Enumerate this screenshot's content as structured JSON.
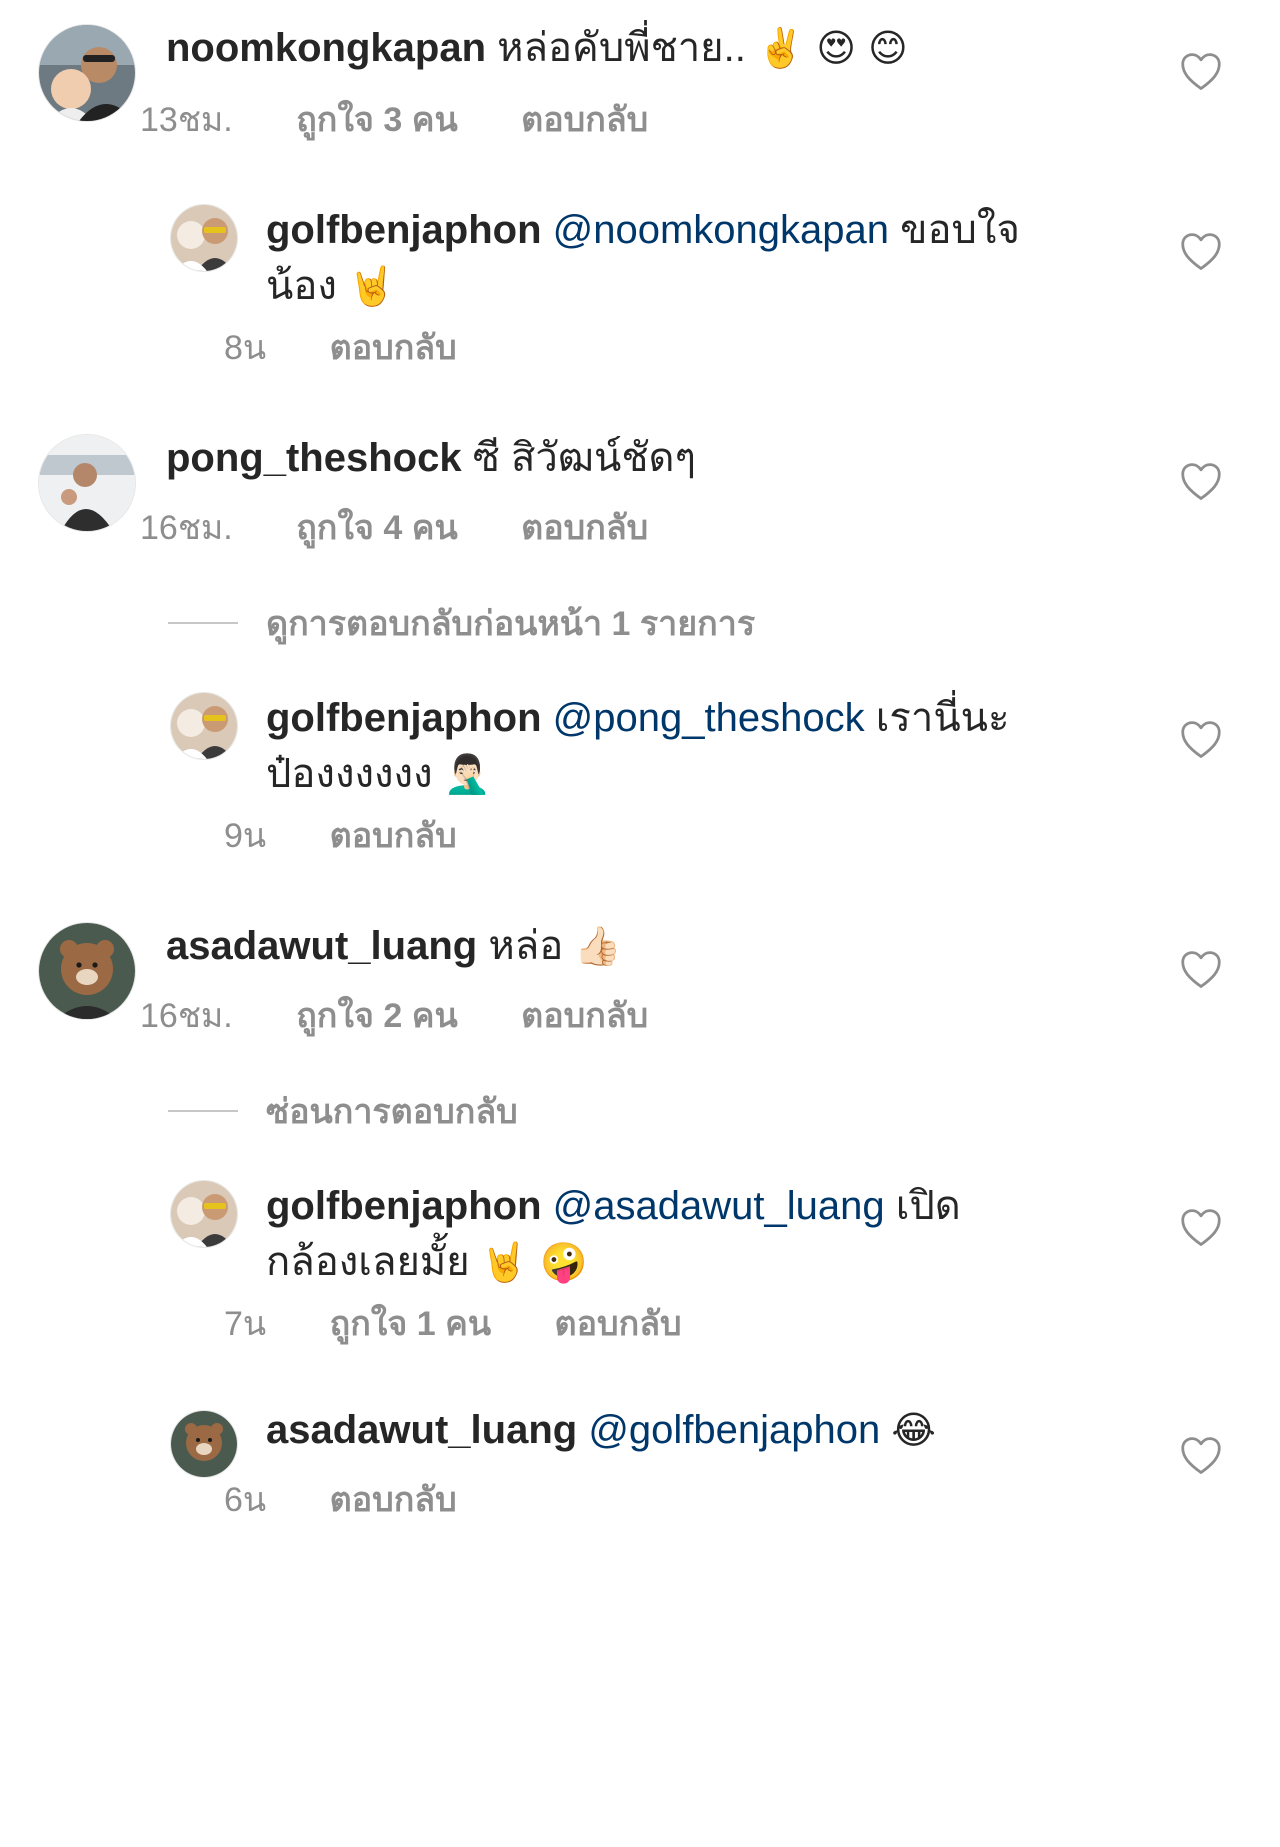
{
  "colors": {
    "username": "#262626",
    "mention": "#00376b",
    "meta": "#8e8e8e",
    "divider": "#c7c7c7"
  },
  "icons": {
    "like": "heart-outline-icon"
  },
  "comments": [
    {
      "username": "noomkongkapan",
      "text": "หล่อคับพี่ชาย..",
      "emoji": "✌️ 😍 😊",
      "time": "13ชม.",
      "likes": "ถูกใจ 3 คน",
      "reply": "ตอบกลับ"
    },
    {
      "username": "golfbenjaphon",
      "mention": "@noomkongkapan",
      "text_a": "ขอบใจ",
      "text_b": "น้อง",
      "emoji": "🤘",
      "time": "8น",
      "reply": "ตอบกลับ"
    },
    {
      "username": "pong_theshock",
      "text": "ซี สิวัฒน์ชัดๆ",
      "time": "16ชม.",
      "likes": "ถูกใจ 4 คน",
      "reply": "ตอบกลับ"
    },
    {
      "username": "golfbenjaphon",
      "mention": "@pong_theshock",
      "text_a": "เรานี่นะ",
      "text_b": "ป๋องงงงงง",
      "emoji": "🤦🏻‍♂️",
      "time": "9น",
      "reply": "ตอบกลับ"
    },
    {
      "username": "asadawut_luang",
      "text": "หล่อ",
      "emoji": "👍🏻",
      "time": "16ชม.",
      "likes": "ถูกใจ 2 คน",
      "reply": "ตอบกลับ"
    },
    {
      "username": "golfbenjaphon",
      "mention": "@asadawut_luang",
      "text_a": "เปิด",
      "text_b": "กล้องเลยมั้ย",
      "emoji": "🤘 🤪",
      "time": "7น",
      "likes": "ถูกใจ 1 คน",
      "reply": "ตอบกลับ"
    },
    {
      "username": "asadawut_luang",
      "mention": "@golfbenjaphon",
      "emoji": "😂",
      "time": "6น",
      "reply": "ตอบกลับ"
    }
  ],
  "view_previous_replies": "ดูการตอบกลับก่อนหน้า 1 รายการ",
  "hide_replies": "ซ่อนการตอบกลับ"
}
